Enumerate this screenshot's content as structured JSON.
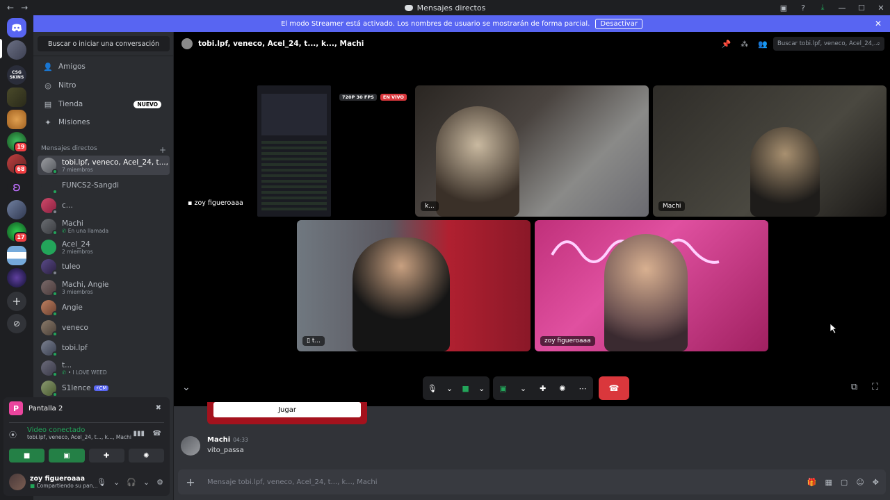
{
  "window": {
    "title": "Mensajes directos"
  },
  "banner": {
    "text": "El modo Streamer está activado. Los nombres de usuario se mostrarán de forma parcial.",
    "button": "Desactivar"
  },
  "sidebar": {
    "search_button": "Buscar o iniciar una conversación",
    "nav": [
      {
        "label": "Amigos",
        "icon": "friends-icon"
      },
      {
        "label": "Nitro",
        "icon": "nitro-icon"
      },
      {
        "label": "Tienda",
        "icon": "shop-icon",
        "badge": "NUEVO"
      },
      {
        "label": "Misiones",
        "icon": "quests-icon"
      }
    ],
    "dm_header": "Mensajes directos",
    "dms": [
      {
        "name": "tobi.lpf, veneco, Acel_24, t..., k...",
        "sub": "7 miembros"
      },
      {
        "name": "FUNCS2-Sangdi",
        "sub": ""
      },
      {
        "name": "c...",
        "sub": ""
      },
      {
        "name": "Machi",
        "sub": "En una llamada"
      },
      {
        "name": "Acel_24",
        "sub": "2 miembros"
      },
      {
        "name": "tuleo",
        "sub": ""
      },
      {
        "name": "Machi, Angie",
        "sub": "3 miembros"
      },
      {
        "name": "Angie",
        "sub": ""
      },
      {
        "name": "veneco",
        "sub": ""
      },
      {
        "name": "tobi.lpf",
        "sub": ""
      },
      {
        "name": "t...",
        "sub": "• I LOVE WEED"
      },
      {
        "name": "S1lence",
        "sub": "",
        "tag": "CM"
      }
    ]
  },
  "guilds": {
    "badges": [
      "19",
      "68",
      "17"
    ],
    "server_text": "CSG SKINS"
  },
  "voice_panel": {
    "title": "Pantalla 2",
    "status": "Video conectado",
    "channel": "tobi.lpf, veneco, Acel_24, t..., k..., Machi"
  },
  "user": {
    "name": "zoy figueroaaa",
    "status": "Compartiendo su pan..."
  },
  "header": {
    "title": "tobi.lpf, veneco, Acel_24, t..., k..., Machi",
    "search_placeholder": "Buscar tobi.lpf, veneco, Acel_24,..."
  },
  "call": {
    "stream_label": "zoy figueroaaa",
    "quality_chip": "720P 30 FPS",
    "live_chip": "EN VIVO",
    "tiles": [
      "k...",
      "Machi",
      "t...",
      "zoy figueroaaa"
    ]
  },
  "chat": {
    "play_button": "Jugar",
    "message": {
      "author": "Machi",
      "time": "04:33",
      "text": "vito_passa"
    },
    "composer_placeholder": "Mensaje tobi.lpf, veneco, Acel_24, t..., k..., Machi"
  },
  "colors": {
    "accent": "#5865f2",
    "green": "#23a55a",
    "red": "#da373c",
    "streamer_bg": "#a4121d"
  }
}
